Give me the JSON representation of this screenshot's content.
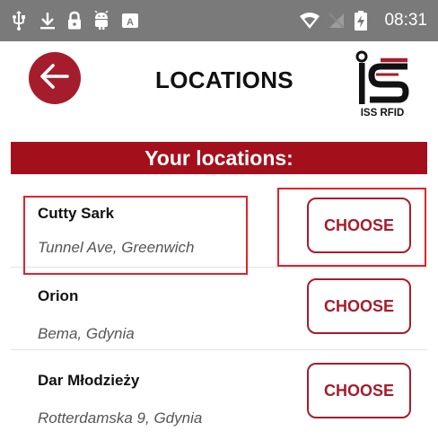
{
  "status_bar": {
    "time": "08:31",
    "icons": [
      "usb-icon",
      "download-icon",
      "lock-icon",
      "android-debug-icon",
      "keyboard-icon",
      "wifi-icon",
      "no-sim-icon",
      "battery-charging-icon"
    ]
  },
  "header": {
    "title": "LOCATIONS",
    "logo_caption": "ISS RFID",
    "back_icon": "arrow-left-icon"
  },
  "banner": {
    "text": "Your locations:"
  },
  "locations": [
    {
      "name": "Cutty Sark",
      "address": "Tunnel Ave, Greenwich",
      "button": "CHOOSE"
    },
    {
      "name": "Orion",
      "address": "Bema, Gdynia",
      "button": "CHOOSE"
    },
    {
      "name": "Dar Młodzieży",
      "address": "Rotterdamska 9, Gdynia",
      "button": "CHOOSE"
    }
  ],
  "colors": {
    "accent": "#a51d2d",
    "banner": "#a3101c",
    "status_bar": "#7a7a7a",
    "highlight": "#e0222d"
  }
}
